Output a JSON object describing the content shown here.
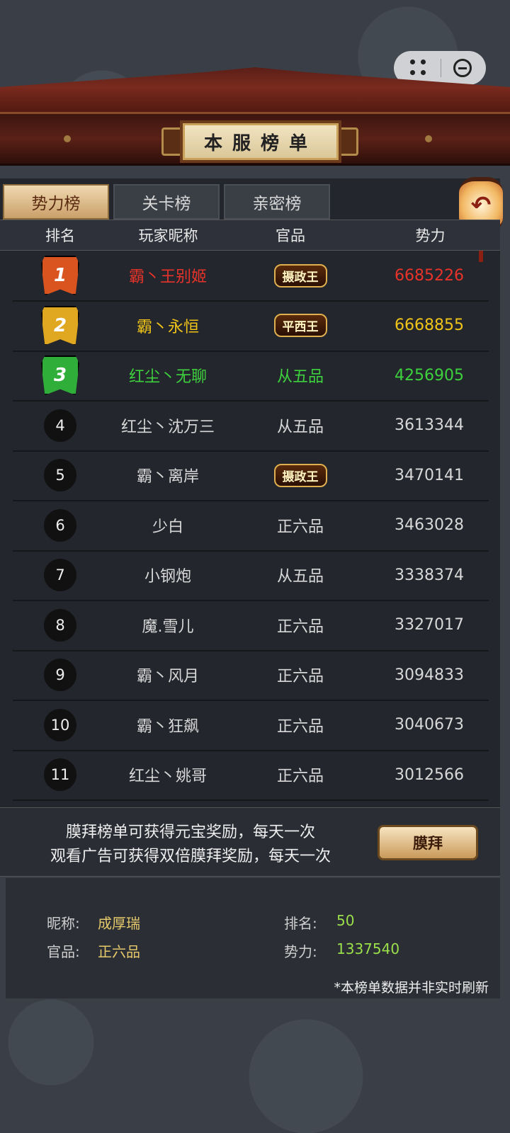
{
  "board_title": "本服榜单",
  "tabs": [
    {
      "label": "势力榜",
      "active": true
    },
    {
      "label": "关卡榜",
      "active": false
    },
    {
      "label": "亲密榜",
      "active": false
    }
  ],
  "columns": {
    "rank": "排名",
    "name": "玩家昵称",
    "title": "官品",
    "power": "势力"
  },
  "rows": [
    {
      "rank": "1",
      "name": "霸丶王别姬",
      "title": "摄政王",
      "title_badge": true,
      "power": "6685226",
      "color": "#e8332a"
    },
    {
      "rank": "2",
      "name": "霸丶永恒",
      "title": "平西王",
      "title_badge": true,
      "power": "6668855",
      "color": "#f0c419"
    },
    {
      "rank": "3",
      "name": "红尘丶无聊",
      "title": "从五品",
      "title_badge": false,
      "power": "4256905",
      "color": "#3ed13e"
    },
    {
      "rank": "4",
      "name": "红尘丶沈万三",
      "title": "从五品",
      "title_badge": false,
      "power": "3613344",
      "color": "#d8d8d8"
    },
    {
      "rank": "5",
      "name": "霸丶离岸",
      "title": "摄政王",
      "title_badge": true,
      "power": "3470141",
      "color": "#d8d8d8"
    },
    {
      "rank": "6",
      "name": "少白",
      "title": "正六品",
      "title_badge": false,
      "power": "3463028",
      "color": "#d8d8d8"
    },
    {
      "rank": "7",
      "name": "小钢炮",
      "title": "从五品",
      "title_badge": false,
      "power": "3338374",
      "color": "#d8d8d8"
    },
    {
      "rank": "8",
      "name": "魔.雪儿",
      "title": "正六品",
      "title_badge": false,
      "power": "3327017",
      "color": "#d8d8d8"
    },
    {
      "rank": "9",
      "name": "霸丶风月",
      "title": "正六品",
      "title_badge": false,
      "power": "3094833",
      "color": "#d8d8d8"
    },
    {
      "rank": "10",
      "name": "霸丶狂飙",
      "title": "正六品",
      "title_badge": false,
      "power": "3040673",
      "color": "#d8d8d8"
    },
    {
      "rank": "11",
      "name": "红尘丶姚哥",
      "title": "正六品",
      "title_badge": false,
      "power": "3012566",
      "color": "#d8d8d8"
    }
  ],
  "worship": {
    "line1": "膜拜榜单可获得元宝奖励，每天一次",
    "line2": "观看广告可获得双倍膜拜奖励，每天一次",
    "button": "膜拜"
  },
  "me": {
    "nickname_label": "昵称:",
    "nickname": "成厚瑞",
    "rank_label": "排名:",
    "rank": "50",
    "title_label": "官品:",
    "title": "正六品",
    "power_label": "势力:",
    "power": "1337540",
    "note": "*本榜单数据并非实时刷新"
  },
  "medal_colors": [
    "#d9541e",
    "#e0a820",
    "#2fae3a"
  ]
}
